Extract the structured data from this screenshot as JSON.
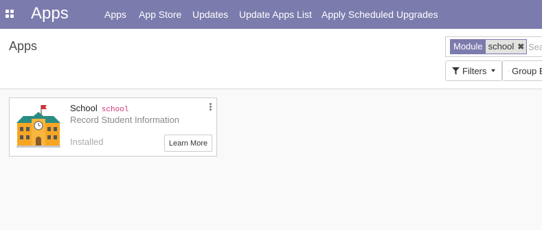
{
  "navbar": {
    "apps_menu_icon": "grid-icon",
    "brand": "Apps",
    "menu": [
      {
        "label": "Apps"
      },
      {
        "label": "App Store"
      },
      {
        "label": "Updates"
      },
      {
        "label": "Update Apps List"
      },
      {
        "label": "Apply Scheduled Upgrades"
      }
    ]
  },
  "control_panel": {
    "title": "Apps",
    "search": {
      "facet_category": "Module",
      "facet_value": "school",
      "placeholder": "Search..."
    },
    "filters_label": "Filters",
    "group_by_label": "Group By"
  },
  "apps": [
    {
      "name": "School",
      "technical_name": "school",
      "summary": "Record Student Information",
      "status": "Installed",
      "action_label": "Learn More",
      "icon": "school-building-icon"
    }
  ],
  "colors": {
    "brand": "#7c7bad",
    "technical_name": "#d2377a"
  }
}
